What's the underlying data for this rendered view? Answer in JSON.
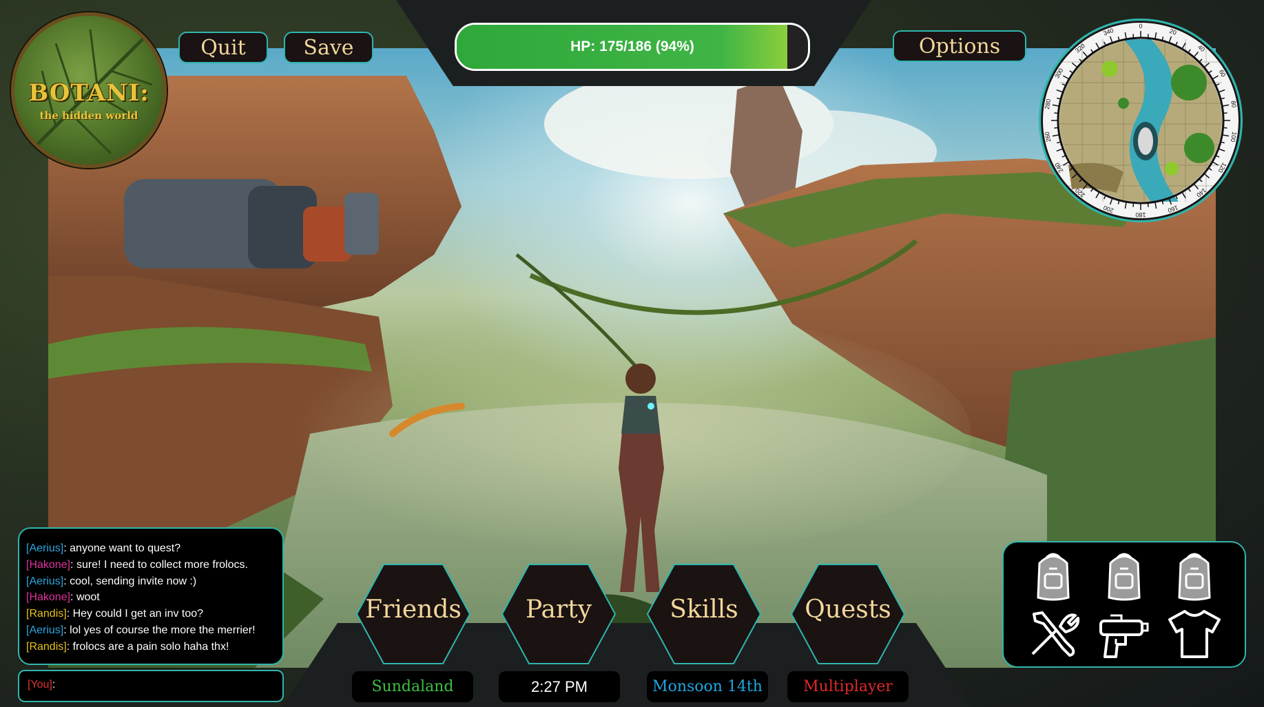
{
  "window": {
    "logo": {
      "title": "BOTANI:",
      "subtitle": "the hidden world"
    }
  },
  "toolbar": {
    "quit_label": "Quit",
    "save_label": "Save",
    "options_label": "Options"
  },
  "hp": {
    "text": "HP: 175/186 (94%)",
    "current": 175,
    "max": 186,
    "percent": 94
  },
  "minimap": {
    "compass_labels": [
      "0",
      "20",
      "40",
      "60",
      "80",
      "100",
      "120",
      "140",
      "160",
      "180",
      "200",
      "220",
      "240",
      "260",
      "280",
      "300",
      "320",
      "340"
    ]
  },
  "chat": {
    "messages": [
      {
        "user": "[Aerius]",
        "text": ": anyone want to quest?",
        "color": "#2aa7e0"
      },
      {
        "user": "[Hakone]",
        "text": ": sure! I need to collect more frolocs.",
        "color": "#e0339f"
      },
      {
        "user": "[Aerius]",
        "text": ": cool, sending invite now :)",
        "color": "#2aa7e0"
      },
      {
        "user": "[Hakone]",
        "text": ": woot",
        "color": "#e0339f"
      },
      {
        "user": "[Randis]",
        "text": ": Hey could I get an inv too?",
        "color": "#e8c21a"
      },
      {
        "user": "[Aerius]",
        "text": ": lol yes of course the more the merrier!",
        "color": "#2aa7e0"
      },
      {
        "user": "[Randis]",
        "text": ": frolocs are a pain solo haha thx!",
        "color": "#e8c21a"
      }
    ],
    "input_user": "[You]",
    "input_suffix": ":",
    "input_color": "#e03333"
  },
  "menu": {
    "friends": "Friends",
    "party": "Party",
    "skills": "Skills",
    "quests": "Quests"
  },
  "status": {
    "location": "Sundaland",
    "location_color": "#3fbf45",
    "time": "2:27 PM",
    "time_color": "#ffffff",
    "date": "Monsoon 14th",
    "date_color": "#1fa6e0",
    "mode": "Multiplayer",
    "mode_color": "#e02a2a"
  },
  "inventory": {
    "slots": [
      "backpack-icon",
      "backpack-icon",
      "backpack-icon",
      "tools-icon",
      "water-gun-icon",
      "shirt-icon"
    ]
  },
  "colors": {
    "accent": "#2fb6ae",
    "gold": "#f1d79a",
    "hp_green": "#3fb545"
  }
}
